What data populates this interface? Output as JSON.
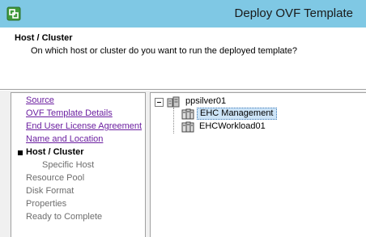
{
  "window": {
    "title": "Deploy OVF Template"
  },
  "header": {
    "title": "Host / Cluster",
    "subtitle": "On which host or cluster do you want to run the deployed template?"
  },
  "nav": {
    "items": [
      {
        "label": "Source",
        "state": "link"
      },
      {
        "label": "OVF Template Details",
        "state": "link"
      },
      {
        "label": "End User License Agreement",
        "state": "link"
      },
      {
        "label": "Name and Location",
        "state": "link"
      },
      {
        "label": "Host / Cluster",
        "state": "current"
      },
      {
        "label": "Specific Host",
        "state": "disabled"
      },
      {
        "label": "Resource Pool",
        "state": "disabled"
      },
      {
        "label": "Disk Format",
        "state": "disabled"
      },
      {
        "label": "Properties",
        "state": "disabled"
      },
      {
        "label": "Ready to Complete",
        "state": "disabled"
      }
    ]
  },
  "tree": {
    "datacenter": {
      "label": "ppsilver01",
      "expanded": true,
      "icon": "datacenter-icon"
    },
    "clusters": [
      {
        "label": "EHC Management",
        "selected": true,
        "icon": "cluster-icon"
      },
      {
        "label": "EHCWorkload01",
        "selected": false,
        "icon": "cluster-icon"
      }
    ]
  },
  "colors": {
    "titlebar": "#7fc8e4",
    "link": "#6b1fa0",
    "selection": "#cde4f7"
  }
}
